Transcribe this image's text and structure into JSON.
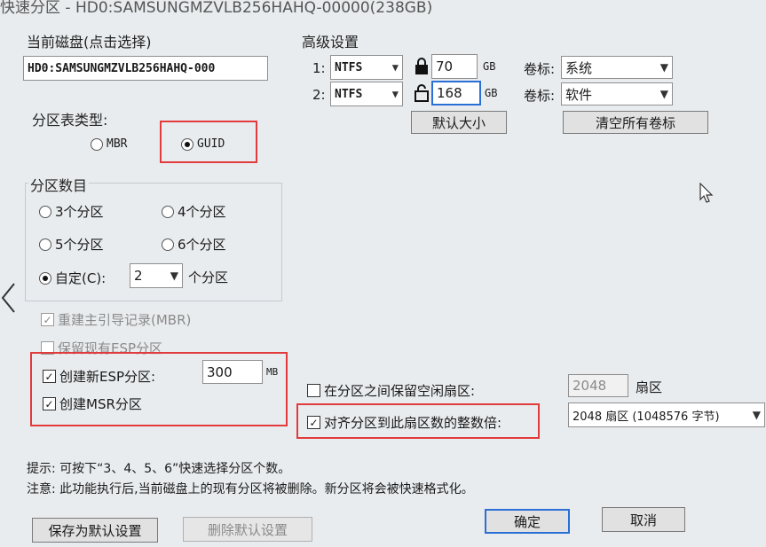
{
  "window": {
    "title": "快速分区 - HD0:SAMSUNGMZVLB256HAHQ-00000(238GB)"
  },
  "disk": {
    "section_label": "当前磁盘(点击选择)",
    "current_disk": "HD0:SAMSUNGMZVLB256HAHQ-000"
  },
  "partition_table": {
    "label": "分区表类型:",
    "options": [
      {
        "label": "MBR",
        "selected": false
      },
      {
        "label": "GUID",
        "selected": true
      }
    ]
  },
  "partition_count": {
    "label": "分区数目",
    "options": [
      {
        "label": "3个分区",
        "selected": false
      },
      {
        "label": "4个分区",
        "selected": false
      },
      {
        "label": "5个分区",
        "selected": false
      },
      {
        "label": "6个分区",
        "selected": false
      }
    ],
    "custom_label": "自定(C):",
    "custom_value": "2",
    "custom_suffix": "个分区"
  },
  "options": {
    "rebuild_mbr": "重建主引导记录(MBR)",
    "keep_esp": "保留现有ESP分区",
    "create_esp": "创建新ESP分区:",
    "esp_size": "300",
    "esp_unit": "MB",
    "create_msr": "创建MSR分区"
  },
  "advanced": {
    "label": "高级设置",
    "rows": [
      {
        "index": "1:",
        "fs": "NTFS",
        "size": "70",
        "unit": "GB",
        "label_caption": "卷标:",
        "volume": "系统"
      },
      {
        "index": "2:",
        "fs": "NTFS",
        "size": "168",
        "unit": "GB",
        "label_caption": "卷标:",
        "volume": "软件"
      }
    ],
    "default_size_button": "默认大小",
    "clear_labels_button": "清空所有卷标"
  },
  "sectors": {
    "reserve_label": "在分区之间保留空闲扇区:",
    "reserve_value": "2048",
    "reserve_unit": "扇区",
    "align_label": "对齐分区到此扇区数的整数倍:",
    "align_value": "2048 扇区 (1048576 字节)"
  },
  "hints": {
    "tip": "提示: 可按下“3、4、5、6”快速选择分区个数。",
    "note": "注意: 此功能执行后,当前磁盘上的现有分区将被删除。新分区将会被快速格式化。"
  },
  "buttons": {
    "save_default": "保存为默认设置",
    "delete_default": "删除默认设置",
    "ok": "确定",
    "cancel": "取消"
  }
}
